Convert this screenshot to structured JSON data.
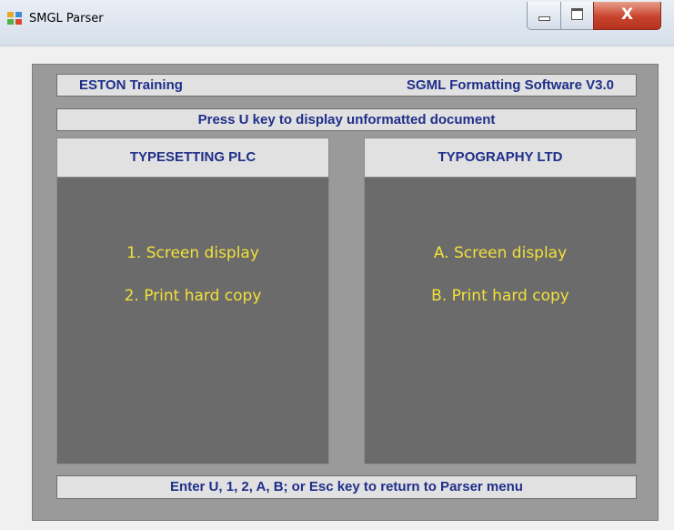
{
  "window": {
    "title": "SMGL Parser",
    "close_glyph": "X"
  },
  "header": {
    "left": "ESTON Training",
    "right": "SGML Formatting Software V3.0"
  },
  "notice": "Press U key to display unformatted document",
  "panels": [
    {
      "title": "TYPESETTING PLC",
      "options": [
        "1.  Screen display",
        "2.  Print hard copy"
      ]
    },
    {
      "title": "TYPOGRAPHY LTD",
      "options": [
        "A.  Screen display",
        "B.  Print hard copy"
      ]
    }
  ],
  "footer": "Enter U, 1, 2, A, B; or Esc key to return to Parser menu",
  "colors": {
    "option_text": "#f2e03a",
    "label_text": "#1f2f8a",
    "panel_bg": "#6b6b6b",
    "frame_bg": "#9a9a9a"
  }
}
